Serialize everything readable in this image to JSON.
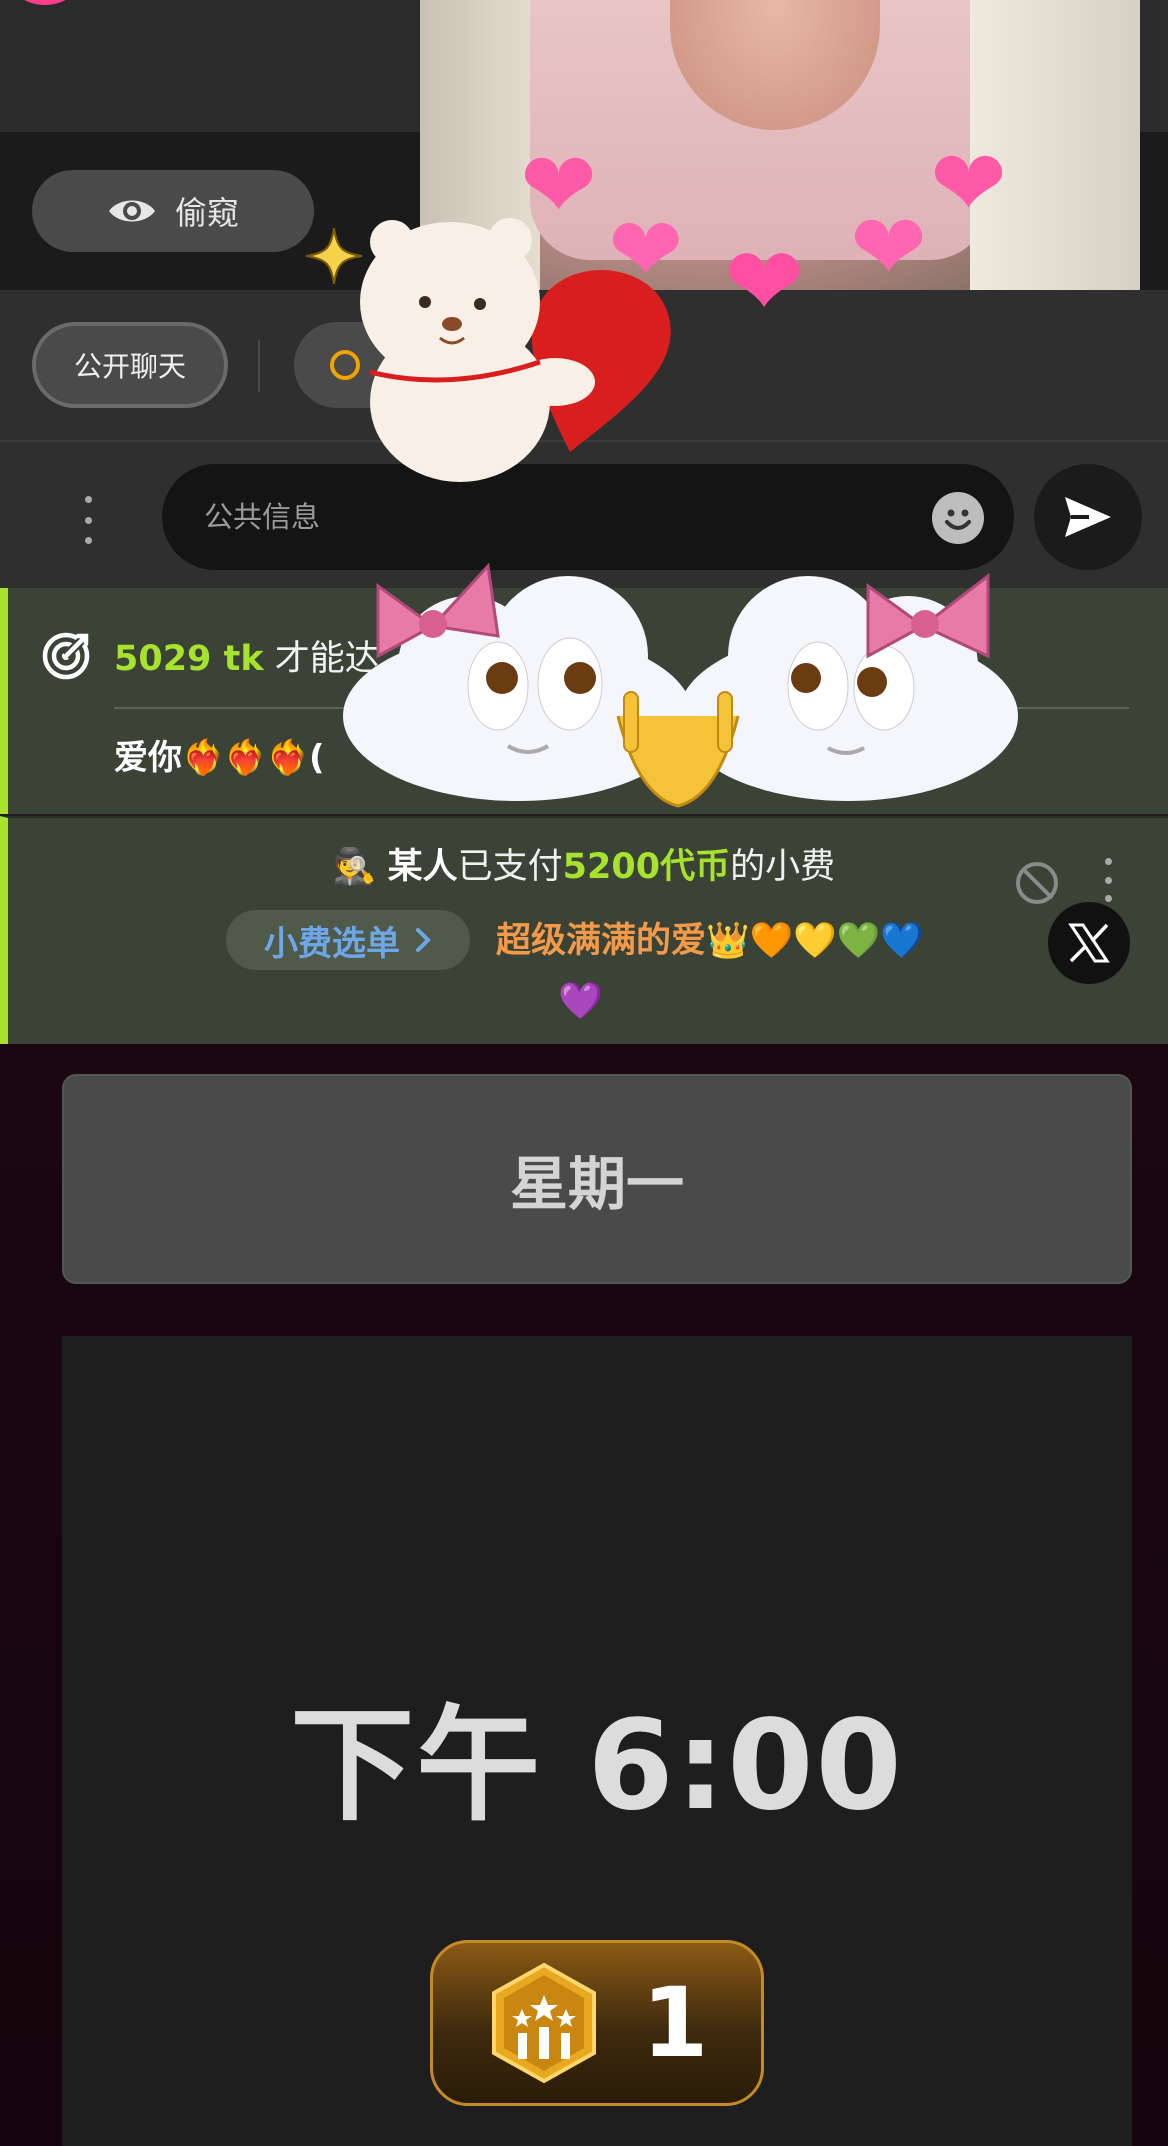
{
  "peek_button": {
    "label": "偷窥",
    "icon": "eye-icon"
  },
  "chat_tabs": {
    "public_label": "公开聊天"
  },
  "message_input": {
    "placeholder": "公共信息"
  },
  "goal": {
    "tokens": "5029 tk",
    "text_visible": "才能达",
    "subtitle_visible": "爱你❤️‍🔥❤️‍🔥❤️‍🔥("
  },
  "tip_event": {
    "sender_icon": "🕵️",
    "sender": "某人",
    "verb": "已支付",
    "amount": "5200代币",
    "suffix": "的小费",
    "menu_label": "小费选单",
    "item_label": "超级满满的爱👑🧡💛💚💙",
    "item_label_cont": "💜"
  },
  "schedule": {
    "day": "星期一",
    "time": "下午 6:00",
    "rank": "1"
  },
  "colors": {
    "accent_green": "#a6e22e",
    "tip_orange": "#f39a4a",
    "menu_blue": "#6ea7e8"
  }
}
